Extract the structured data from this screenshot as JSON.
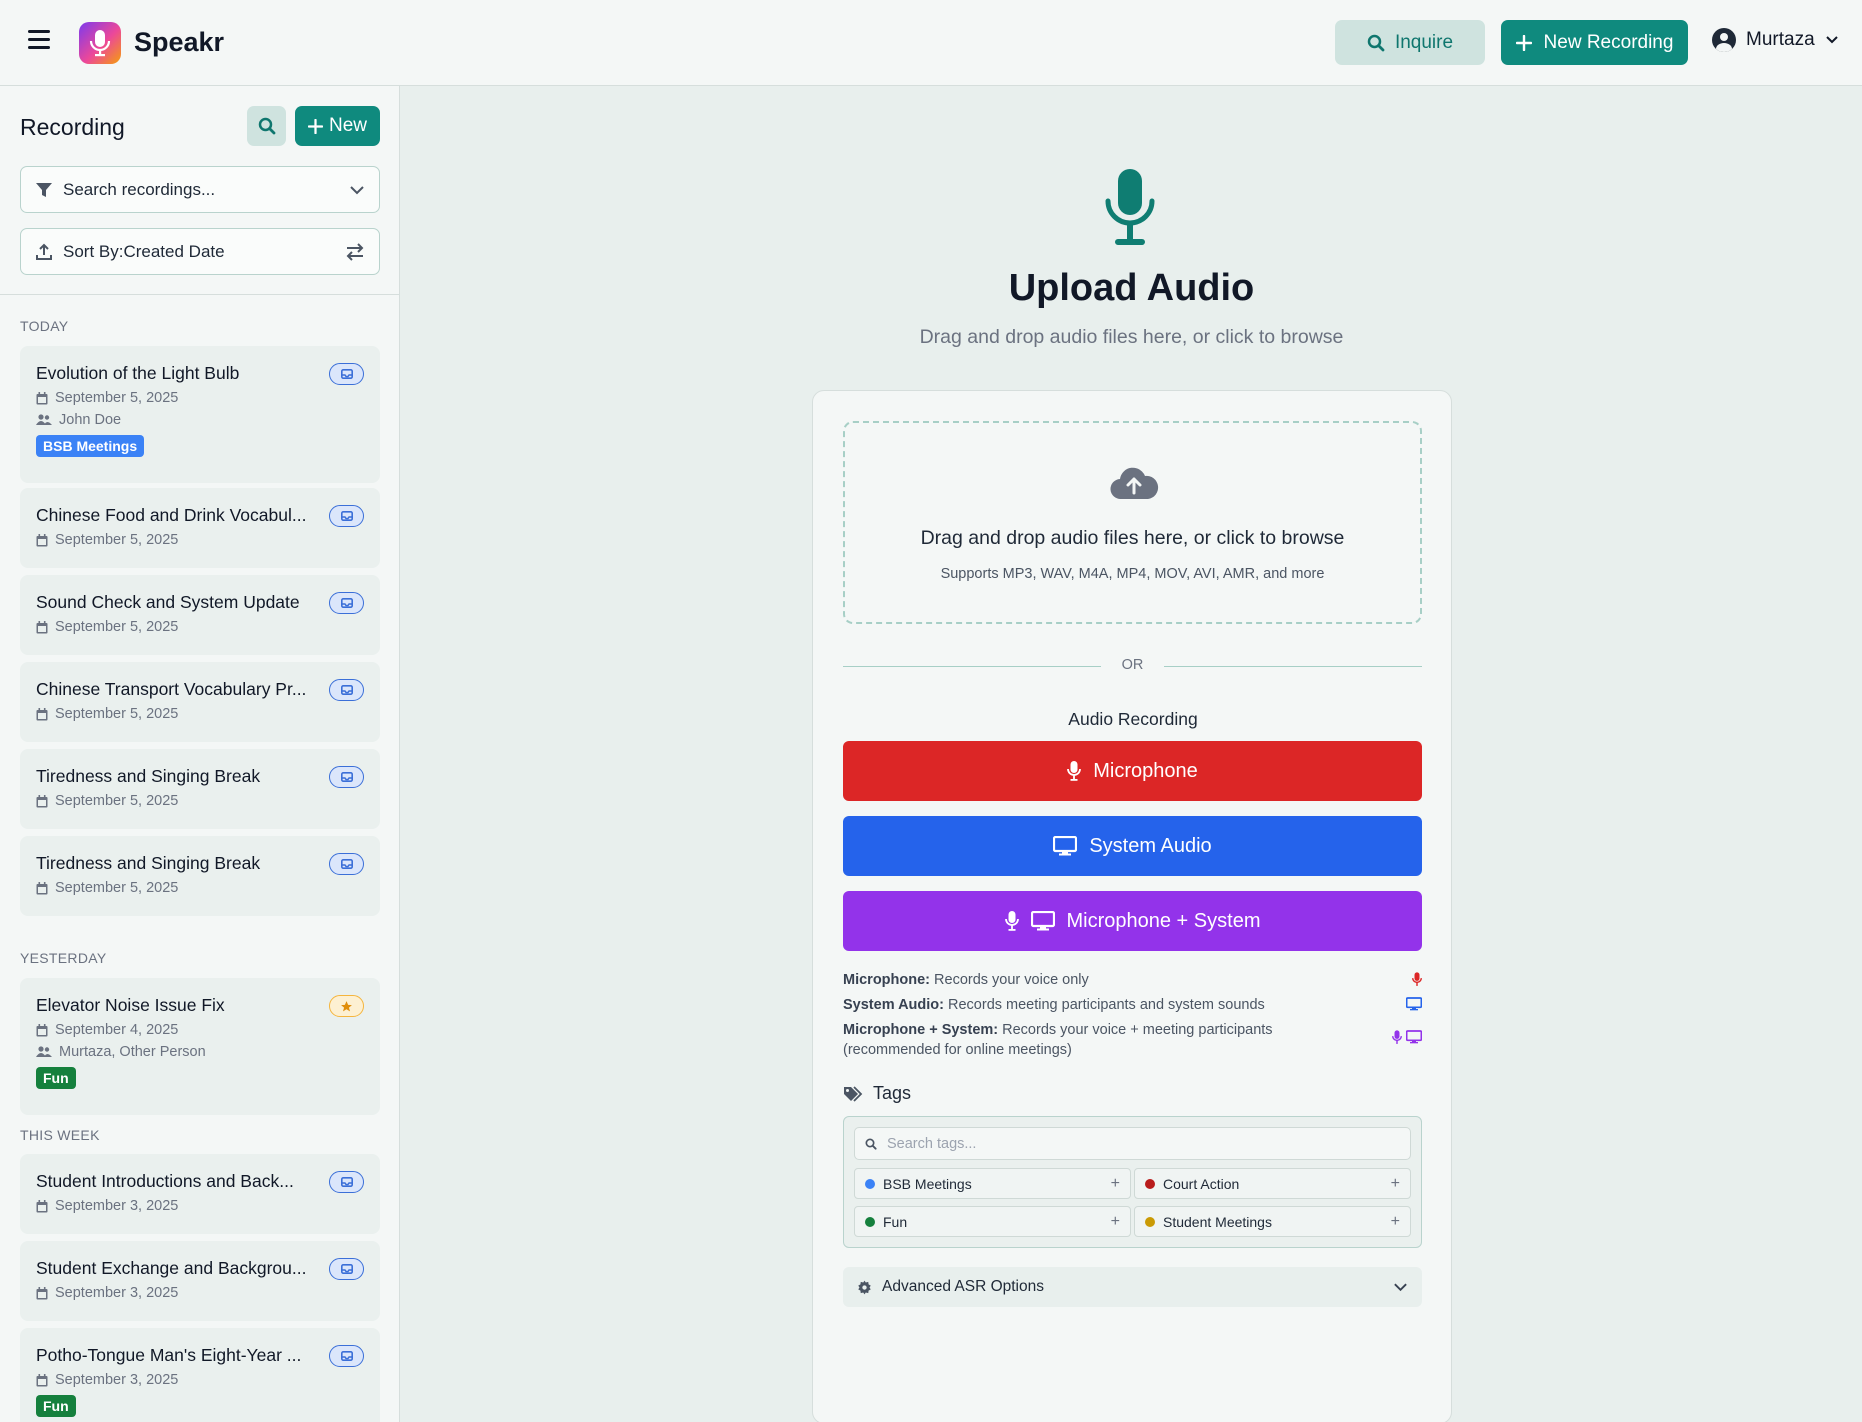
{
  "app": {
    "name": "Speakr"
  },
  "header": {
    "inquire_label": "Inquire",
    "new_recording_label": "New Recording",
    "user_name": "Murtaza"
  },
  "sidebar": {
    "title": "Recording",
    "new_label": "New",
    "search_placeholder": "Search recordings...",
    "sort_label": "Sort By:Created Date",
    "groups": [
      {
        "label": "TODAY"
      },
      {
        "label": "YESTERDAY"
      },
      {
        "label": "THIS WEEK"
      }
    ],
    "recordings": [
      {
        "title": "Evolution of the Light Bulb",
        "date": "September 5, 2025",
        "participants": "John Doe",
        "tag": "BSB Meetings",
        "tag_color": "#3b82f6",
        "badge": "inbox"
      },
      {
        "title": "Chinese Food and Drink Vocabul...",
        "date": "September 5, 2025",
        "badge": "inbox"
      },
      {
        "title": "Sound Check and System Update",
        "date": "September 5, 2025",
        "badge": "inbox"
      },
      {
        "title": "Chinese Transport Vocabulary Pr...",
        "date": "September 5, 2025",
        "badge": "inbox"
      },
      {
        "title": "Tiredness and Singing Break",
        "date": "September 5, 2025",
        "badge": "inbox"
      },
      {
        "title": "Tiredness and Singing Break",
        "date": "September 5, 2025",
        "badge": "inbox"
      },
      {
        "title": "Elevator Noise Issue Fix",
        "date": "September 4, 2025",
        "participants": "Murtaza, Other Person",
        "tag": "Fun",
        "tag_color": "#15803d",
        "badge": "star"
      },
      {
        "title": "Student Introductions and Back...",
        "date": "September 3, 2025",
        "badge": "inbox"
      },
      {
        "title": "Student Exchange and Backgrou...",
        "date": "September 3, 2025",
        "badge": "inbox"
      },
      {
        "title": "Potho-Tongue Man's Eight-Year ...",
        "date": "September 3, 2025",
        "tag": "Fun",
        "tag_color": "#15803d",
        "badge": "inbox"
      }
    ]
  },
  "main": {
    "title": "Upload Audio",
    "subtitle": "Drag and drop audio files here, or click to browse",
    "dropzone_text": "Drag and drop audio files here, or click to browse",
    "dropzone_formats": "Supports MP3, WAV, M4A, MP4, MOV, AVI, AMR, and more",
    "or_label": "OR",
    "audio_recording_label": "Audio Recording",
    "buttons": {
      "microphone": "Microphone",
      "system_audio": "System Audio",
      "mic_system": "Microphone + System"
    },
    "info": [
      {
        "term": "Microphone:",
        "desc": "Records your voice only"
      },
      {
        "term": "System Audio:",
        "desc": "Records meeting participants and system sounds"
      },
      {
        "term": "Microphone + System:",
        "desc": "Records your voice + meeting participants (recommended for online meetings)"
      }
    ],
    "tags_label": "Tags",
    "tags_search_placeholder": "Search tags...",
    "tags": [
      {
        "name": "BSB Meetings",
        "color": "#3b82f6"
      },
      {
        "name": "Court Action",
        "color": "#b91c1c"
      },
      {
        "name": "Fun",
        "color": "#15803d"
      },
      {
        "name": "Student Meetings",
        "color": "#ca9a04"
      }
    ],
    "advanced_label": "Advanced ASR Options"
  },
  "colors": {
    "accent": "#0f8a7e",
    "microphone": "#dc2626",
    "system": "#2563eb",
    "combined": "#9333ea"
  }
}
